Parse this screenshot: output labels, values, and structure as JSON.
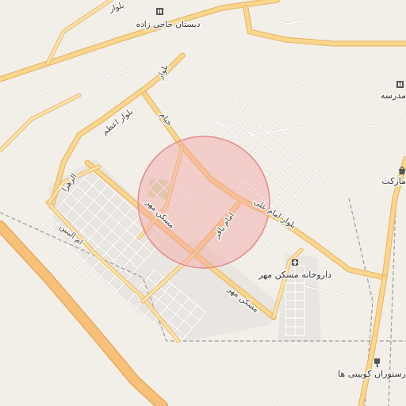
{
  "map": {
    "labels": {
      "top_left_road": "بلوار",
      "school_haji_zadeh": "دبستان حاجی زاده",
      "khayyam": "خیام",
      "bolvar": "بلوار",
      "bolvar_azam": "بلوار اعظم",
      "al_zahra": "الزهرا",
      "maskan_mehr_upper": "مسکن مهر",
      "maskan_mehr_lower": "مسکن مهر",
      "imam_bagher": "امام باقر",
      "bolvar_imam_ali": "بلوار امام علی",
      "umm_al_banin": "ام البنین",
      "pharmacy": "داروخانه مسکن مهر",
      "market": "مارکت",
      "madrese": "مدرسه",
      "restaurant": "رستوران کوبیتی ها"
    },
    "icons": {
      "school_top": "school-icon",
      "school_right": "school-icon",
      "pharmacy": "pharmacy-icon",
      "market": "shop-icon",
      "restaurant": "restaurant-icon"
    },
    "colors": {
      "background": "#f2efe9",
      "major_road": "#fbd68d",
      "motorway": "#f9c07a",
      "highlight_circle": "#f4a5a5",
      "park": "#cfe3b3"
    }
  }
}
